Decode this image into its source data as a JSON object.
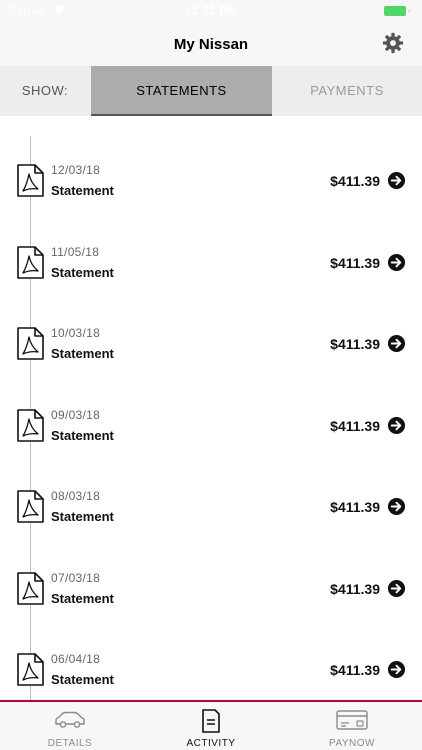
{
  "status_bar": {
    "carrier": "Carrier",
    "time": "12:22 PM"
  },
  "header": {
    "title": "My Nissan",
    "settings_icon": "gear-icon"
  },
  "filter": {
    "show_label": "SHOW:",
    "tabs": [
      {
        "label": "STATEMENTS",
        "selected": true
      },
      {
        "label": "PAYMENTS",
        "selected": false
      }
    ]
  },
  "statements": [
    {
      "date": "12/03/18",
      "title": "Statement",
      "amount": "$411.39"
    },
    {
      "date": "11/05/18",
      "title": "Statement",
      "amount": "$411.39"
    },
    {
      "date": "10/03/18",
      "title": "Statement",
      "amount": "$411.39"
    },
    {
      "date": "09/03/18",
      "title": "Statement",
      "amount": "$411.39"
    },
    {
      "date": "08/03/18",
      "title": "Statement",
      "amount": "$411.39"
    },
    {
      "date": "07/03/18",
      "title": "Statement",
      "amount": "$411.39"
    },
    {
      "date": "06/04/18",
      "title": "Statement",
      "amount": "$411.39"
    }
  ],
  "tab_bar": {
    "items": [
      {
        "label": "DETAILS",
        "icon": "car-icon",
        "active": false
      },
      {
        "label": "ACTIVITY",
        "icon": "document-icon",
        "active": true
      },
      {
        "label": "PAYNOW",
        "icon": "credit-card-icon",
        "active": false
      }
    ]
  },
  "colors": {
    "accent_red": "#c3002f",
    "selected_tab_bg": "#acacac",
    "filter_bg": "#ededed",
    "battery_green": "#4cd964"
  }
}
